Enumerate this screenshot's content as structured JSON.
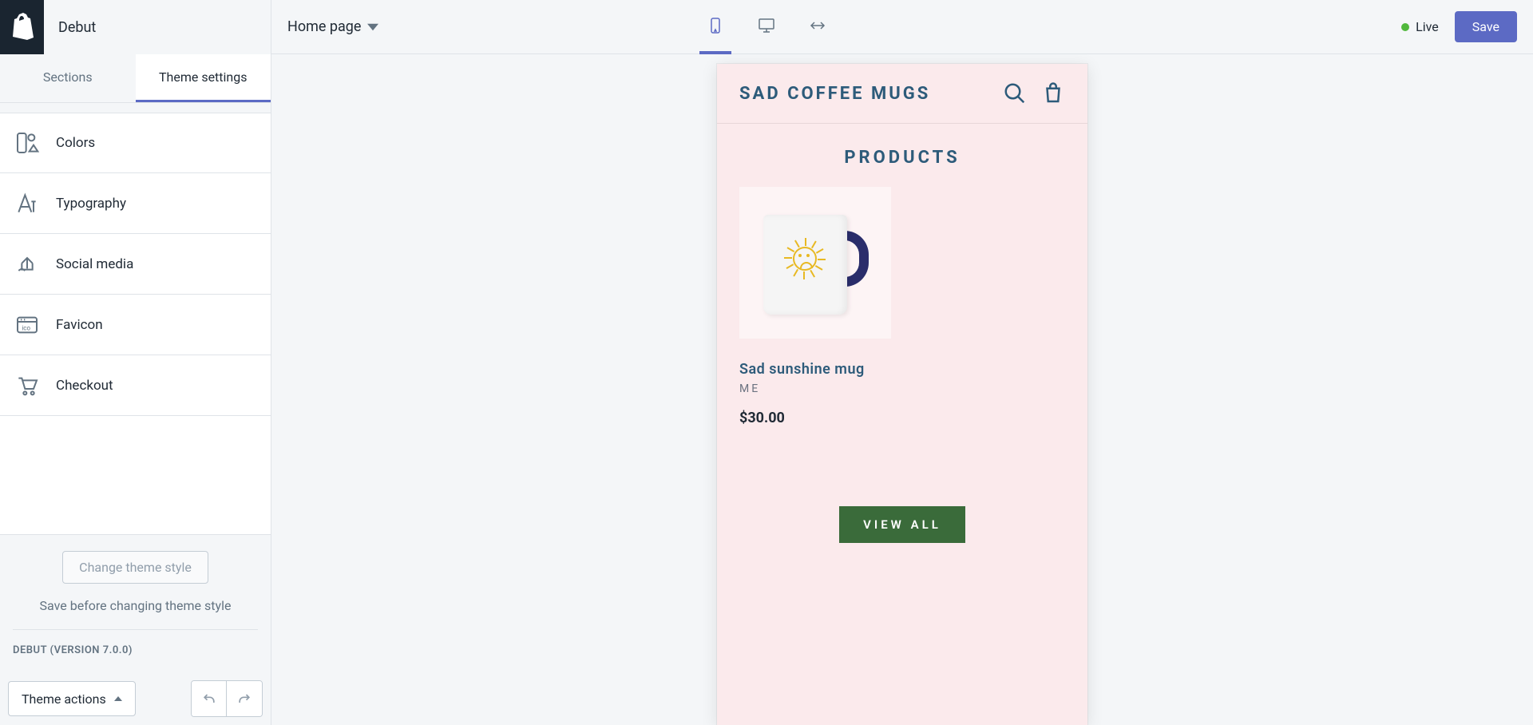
{
  "header": {
    "theme_name": "Debut",
    "page_selector": "Home page",
    "live_label": "Live",
    "save_label": "Save"
  },
  "tabs": {
    "sections": "Sections",
    "theme_settings": "Theme settings"
  },
  "settings": [
    {
      "label": "Colors"
    },
    {
      "label": "Typography"
    },
    {
      "label": "Social media"
    },
    {
      "label": "Favicon"
    },
    {
      "label": "Checkout"
    }
  ],
  "sidebar_lower": {
    "change_theme_label": "Change theme style",
    "save_hint": "Save before changing theme style",
    "version": "DEBUT (VERSION 7.0.0)"
  },
  "footer": {
    "theme_actions_label": "Theme actions"
  },
  "preview": {
    "store_title": "SAD COFFEE MUGS",
    "section_title": "PRODUCTS",
    "product": {
      "title": "Sad sunshine mug",
      "vendor": "ME",
      "price": "$30.00"
    },
    "view_all_label": "VIEW ALL"
  }
}
